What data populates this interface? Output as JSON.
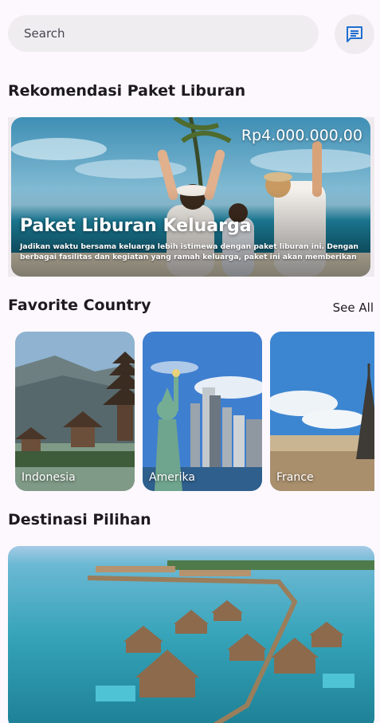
{
  "search": {
    "placeholder": "Search"
  },
  "header": {
    "chat_icon": "chat-bubble-icon",
    "accent": "#1f6fd0"
  },
  "sections": {
    "recommendation_title": "Rekomendasi Paket Liburan",
    "favorite_title": "Favorite Country",
    "see_all": "See All",
    "destination_title": "Destinasi Pilihan"
  },
  "promo": {
    "price": "Rp4.000.000,00",
    "title": "Paket Liburan Keluarga",
    "description": "Jadikan waktu bersama keluarga lebih istimewa dengan paket liburan ini. Dengan berbagai fasilitas dan kegiatan yang ramah keluarga, paket ini akan memberikan"
  },
  "countries": [
    {
      "name": "Indonesia"
    },
    {
      "name": "Amerika"
    },
    {
      "name": "France"
    }
  ]
}
